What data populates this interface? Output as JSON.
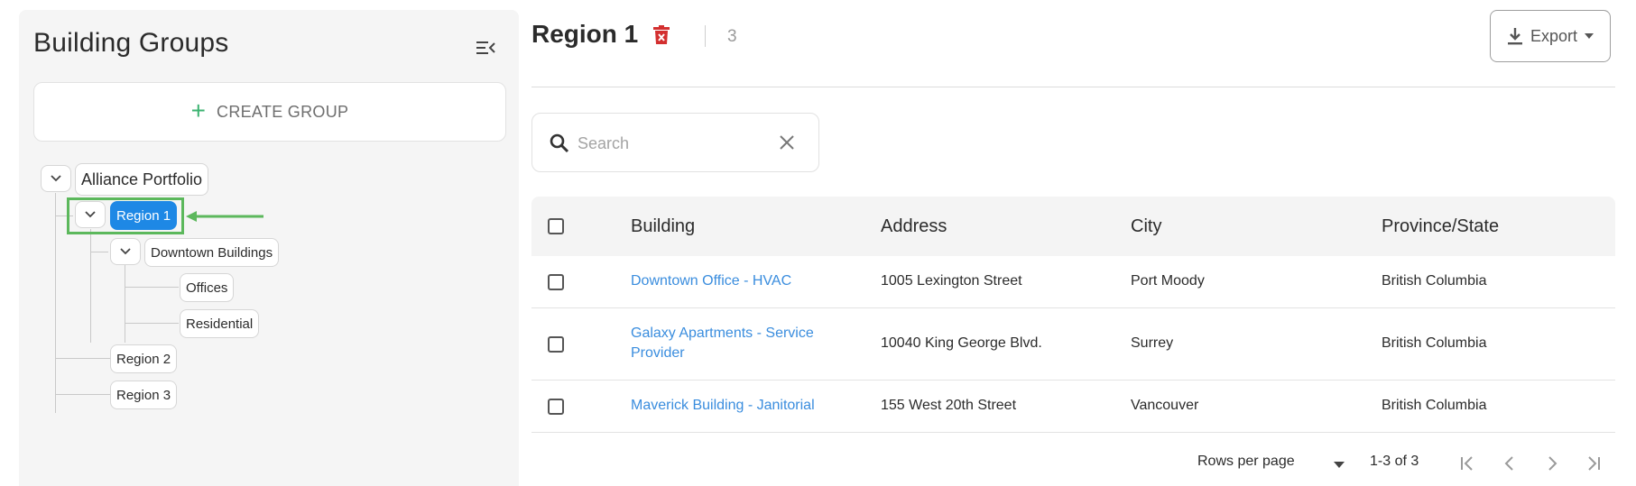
{
  "sidebar": {
    "title": "Building Groups",
    "create_group_label": "CREATE GROUP",
    "tree": {
      "root": "Alliance Portfolio",
      "region1": "Region 1",
      "downtown": "Downtown Buildings",
      "offices": "Offices",
      "residential": "Residential",
      "region2": "Region 2",
      "region3": "Region 3"
    }
  },
  "header": {
    "title": "Region 1",
    "count": "3",
    "export_label": "Export"
  },
  "search": {
    "placeholder": "Search",
    "value": ""
  },
  "table": {
    "columns": [
      "Building",
      "Address",
      "City",
      "Province/State"
    ],
    "rows": [
      {
        "building": "Downtown Office - HVAC",
        "address": "1005 Lexington Street",
        "city": "Port Moody",
        "province": "British Columbia"
      },
      {
        "building_line1": "Galaxy Apartments - Service",
        "building_line2": "Provider",
        "address": "10040 King George Blvd.",
        "city": "Surrey",
        "province": "British Columbia"
      },
      {
        "building": "Maverick Building - Janitorial",
        "address": "155 West 20th Street",
        "city": "Vancouver",
        "province": "British Columbia"
      }
    ]
  },
  "pagination": {
    "rows_per_page_label": "Rows per page",
    "range": "1-3 of 3"
  },
  "colors": {
    "selected_node": "#1e88e5",
    "link": "#3a8dde",
    "delete": "#d32f2f",
    "highlight": "#5cb85c",
    "plus": "#3cb371"
  }
}
